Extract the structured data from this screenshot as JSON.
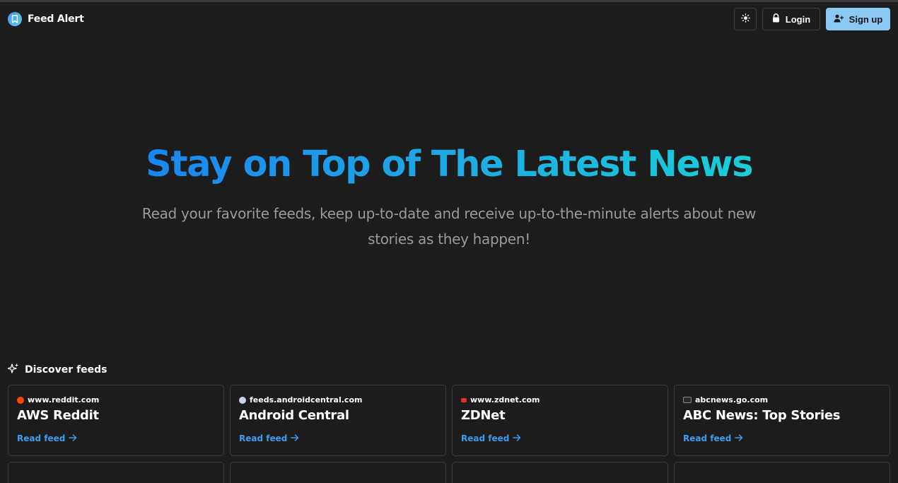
{
  "header": {
    "brand_title": "Feed Alert",
    "login_label": "Login",
    "signup_label": "Sign up"
  },
  "hero": {
    "title": "Stay on Top of The Latest News",
    "subtitle_line1": "Read your favorite feeds, keep up-to-date and receive up-to-the-minute alerts about new",
    "subtitle_line2": "stories as they happen!"
  },
  "discover": {
    "label": "Discover feeds",
    "cards": [
      {
        "domain": "www.reddit.com",
        "title": "AWS Reddit",
        "link": "Read feed",
        "favicon_color": "#ff4500"
      },
      {
        "domain": "feeds.androidcentral.com",
        "title": "Android Central",
        "link": "Read feed",
        "favicon_color": "#c9d4e6"
      },
      {
        "domain": "www.zdnet.com",
        "title": "ZDNet",
        "link": "Read feed",
        "favicon_color": "#e2302f"
      },
      {
        "domain": "abcnews.go.com",
        "title": "ABC News: Top Stories",
        "link": "Read feed",
        "favicon_color": "#2a2a2a"
      }
    ]
  },
  "colors": {
    "background": "#1c1c1c",
    "accent": "#3b9cf0",
    "signup_bg": "#8cc8f4",
    "gradient_start": "#1a86f0",
    "gradient_end": "#18cfd8"
  }
}
